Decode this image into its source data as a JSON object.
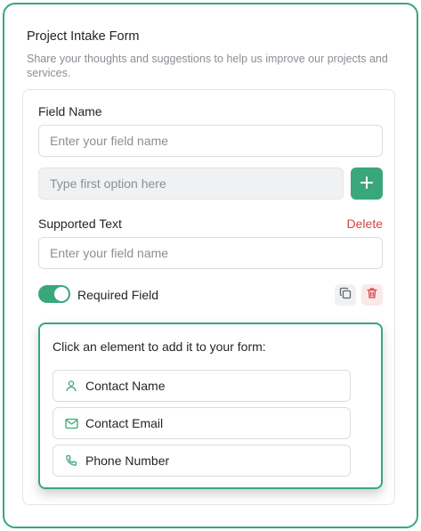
{
  "form": {
    "title": "Project Intake Form",
    "subtitle": "Share your thoughts and suggestions to help us improve our projects and services."
  },
  "field_card": {
    "field_name_label": "Field Name",
    "field_name_placeholder": "Enter your field name",
    "option_placeholder": "Type first option here",
    "add_icon": "plus-icon",
    "supported_text_label": "Supported Text",
    "delete_label": "Delete",
    "supported_text_placeholder": "Enter your field name",
    "required_label": "Required Field",
    "required_on": true,
    "copy_icon": "copy-icon",
    "trash_icon": "trash-icon"
  },
  "element_picker": {
    "title": "Click an element to add it to your form:",
    "options": [
      {
        "label": "Contact Name",
        "icon": "user-icon"
      },
      {
        "label": "Contact Email",
        "icon": "mail-icon"
      },
      {
        "label": "Phone Number",
        "icon": "phone-icon"
      }
    ]
  },
  "colors": {
    "accent": "#3aa77a",
    "danger": "#d64545",
    "muted_text": "#8a8f96"
  }
}
